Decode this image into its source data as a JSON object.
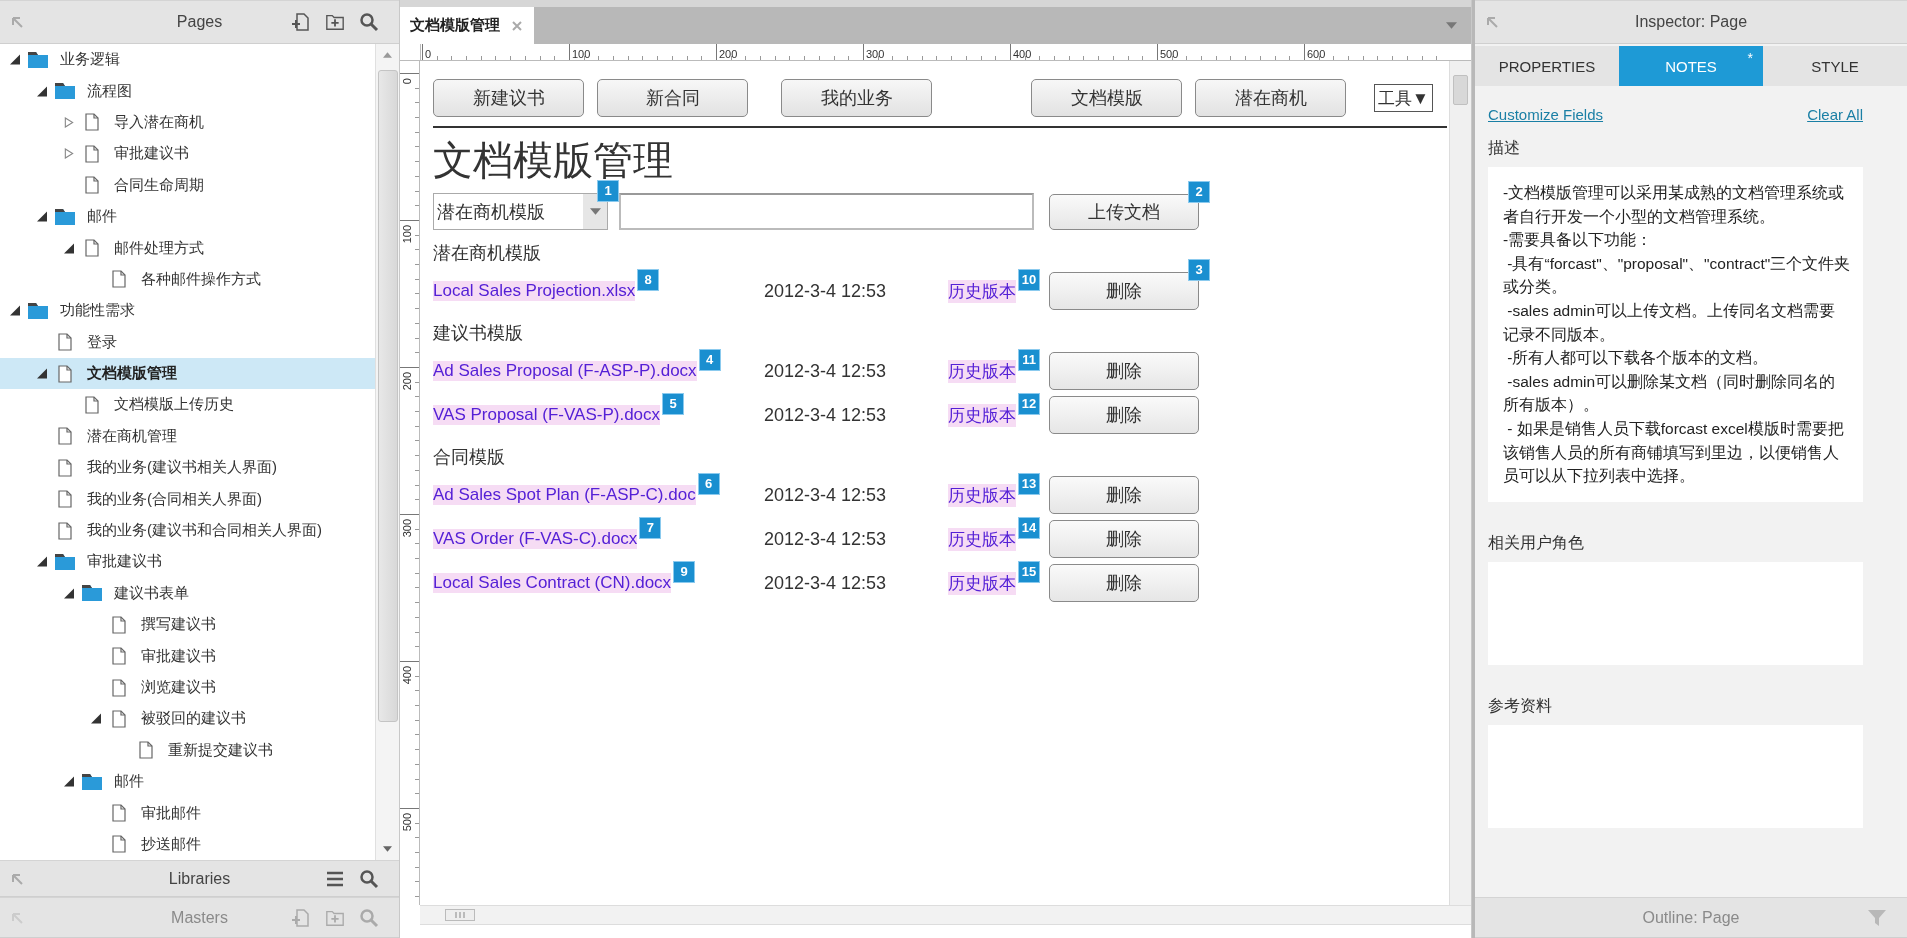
{
  "pages_panel": {
    "title": "Pages",
    "tree": [
      {
        "label": "业务逻辑",
        "kind": "folder",
        "expanded": true,
        "selected": false,
        "children": [
          {
            "label": "流程图",
            "kind": "folder",
            "expanded": true,
            "selected": false,
            "children": [
              {
                "label": "导入潜在商机",
                "kind": "page",
                "expanded": false,
                "selected": false
              },
              {
                "label": "审批建议书",
                "kind": "page",
                "expanded": false,
                "selected": false
              },
              {
                "label": "合同生命周期",
                "kind": "page",
                "selected": false
              }
            ]
          },
          {
            "label": "邮件",
            "kind": "folder",
            "expanded": true,
            "selected": false,
            "children": [
              {
                "label": "邮件处理方式",
                "kind": "page",
                "expanded": true,
                "selected": false,
                "children": [
                  {
                    "label": "各种邮件操作方式",
                    "kind": "page",
                    "selected": false
                  }
                ]
              }
            ]
          }
        ]
      },
      {
        "label": "功能性需求",
        "kind": "folder",
        "expanded": true,
        "selected": false,
        "children": [
          {
            "label": "登录",
            "kind": "page",
            "selected": false
          },
          {
            "label": "文档模版管理",
            "kind": "page",
            "expanded": true,
            "selected": true,
            "children": [
              {
                "label": "文档模版上传历史",
                "kind": "page",
                "selected": false
              }
            ]
          },
          {
            "label": "潜在商机管理",
            "kind": "page",
            "selected": false
          },
          {
            "label": "我的业务(建议书相关人界面)",
            "kind": "page",
            "selected": false
          },
          {
            "label": "我的业务(合同相关人界面)",
            "kind": "page",
            "selected": false
          },
          {
            "label": "我的业务(建议书和合同相关人界面)",
            "kind": "page",
            "selected": false
          },
          {
            "label": "审批建议书",
            "kind": "folder",
            "expanded": true,
            "selected": false,
            "children": [
              {
                "label": "建议书表单",
                "kind": "folder",
                "expanded": true,
                "selected": false,
                "children": [
                  {
                    "label": "撰写建议书",
                    "kind": "page",
                    "selected": false
                  },
                  {
                    "label": "审批建议书",
                    "kind": "page",
                    "selected": false
                  },
                  {
                    "label": "浏览建议书",
                    "kind": "page",
                    "selected": false
                  },
                  {
                    "label": "被驳回的建议书",
                    "kind": "page",
                    "expanded": true,
                    "selected": false,
                    "children": [
                      {
                        "label": "重新提交建议书",
                        "kind": "page",
                        "selected": false
                      }
                    ]
                  }
                ]
              },
              {
                "label": "邮件",
                "kind": "folder",
                "expanded": true,
                "selected": false,
                "children": [
                  {
                    "label": "审批邮件",
                    "kind": "page",
                    "selected": false
                  },
                  {
                    "label": "抄送邮件",
                    "kind": "page",
                    "selected": false
                  }
                ]
              }
            ]
          }
        ]
      }
    ]
  },
  "libraries_panel": {
    "title": "Libraries"
  },
  "masters_panel": {
    "title": "Masters"
  },
  "document_tab": {
    "label": "文档模版管理"
  },
  "ruler": {
    "horizontal": [
      "0",
      "100",
      "200",
      "300",
      "400",
      "500",
      "600"
    ],
    "vertical": [
      "0",
      "100",
      "200",
      "300",
      "400",
      "500"
    ]
  },
  "canvas": {
    "nav_buttons": [
      "新建议书",
      "新合同",
      "我的业务",
      "文档模版",
      "潜在商机"
    ],
    "tools_dropdown": "工具▼",
    "title": "文档模版管理",
    "category_select": {
      "value": "潜在商机模版",
      "note": "1"
    },
    "upload_button": {
      "label": "上传文档",
      "note": "2"
    },
    "sections": [
      {
        "heading": "潜在商机模版",
        "rows": [
          {
            "file": "Local Sales Projection.xlsx",
            "file_note": "8",
            "date": "2012-3-4 12:53",
            "history": "历史版本",
            "history_note": "10",
            "delete": "删除",
            "delete_note": "3"
          }
        ]
      },
      {
        "heading": "建议书模版",
        "rows": [
          {
            "file": "Ad Sales Proposal (F-ASP-P).docx",
            "file_note": "4",
            "date": "2012-3-4 12:53",
            "history": "历史版本",
            "history_note": "11",
            "delete": "删除"
          },
          {
            "file": "VAS Proposal (F-VAS-P).docx",
            "file_note": "5",
            "date": "2012-3-4 12:53",
            "history": "历史版本",
            "history_note": "12",
            "delete": "删除"
          }
        ]
      },
      {
        "heading": "合同模版",
        "rows": [
          {
            "file": "Ad Sales Spot Plan (F-ASP-C).doc",
            "file_note": "6",
            "date": "2012-3-4 12:53",
            "history": "历史版本",
            "history_note": "13",
            "delete": "删除"
          },
          {
            "file": "VAS Order (F-VAS-C).docx",
            "file_note": "7",
            "date": "2012-3-4 12:53",
            "history": "历史版本",
            "history_note": "14",
            "delete": "删除"
          },
          {
            "file": "Local Sales Contract (CN).docx",
            "file_note": "9",
            "date": "2012-3-4 12:53",
            "history": "历史版本",
            "history_note": "15",
            "delete": "删除"
          }
        ]
      }
    ]
  },
  "inspector": {
    "title": "Inspector: Page",
    "tabs": [
      {
        "label": "PROPERTIES",
        "selected": false
      },
      {
        "label": "NOTES",
        "selected": true,
        "marker": "*"
      },
      {
        "label": "STYLE",
        "selected": false
      }
    ],
    "links": [
      "Customize Fields",
      "Clear All"
    ],
    "fields": [
      {
        "label": "描述",
        "value": "-文档模版管理可以采用某成熟的文档管理系统或者自行开发一个小型的文档管理系统。\n-需要具备以下功能：\n -具有“forcast\"、\"proposal\"、\"contract\"三个文件夹或分类。\n -sales admin可以上传文档。上传同名文档需要记录不同版本。\n -所有人都可以下载各个版本的文档。\n -sales admin可以删除某文档（同时删除同名的所有版本）。\n - 如果是销售人员下载forcast excel模版时需要把该销售人员的所有商铺填写到里边，以便销售人员可以从下拉列表中选择。"
      },
      {
        "label": "相关用户角色"
      },
      {
        "label": "参考资料"
      }
    ]
  },
  "outline_panel": {
    "title": "Outline: Page"
  }
}
